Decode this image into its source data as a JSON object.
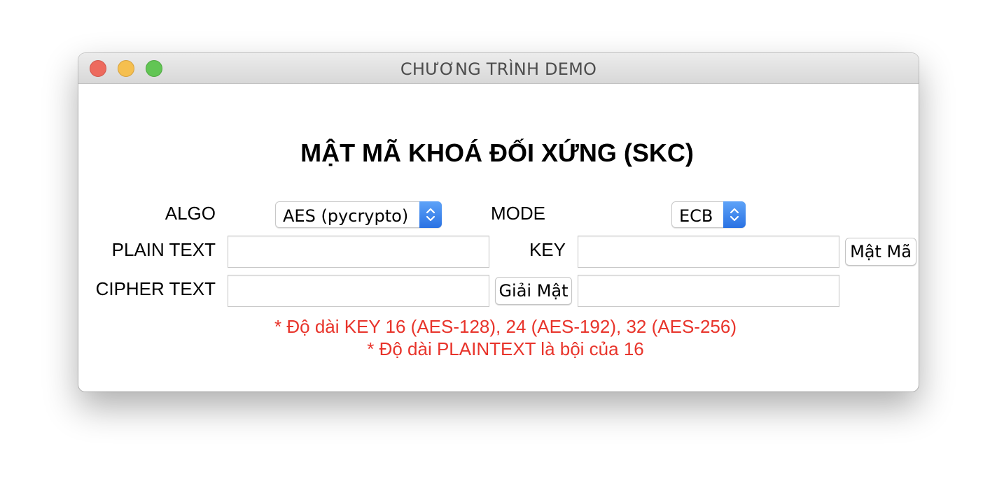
{
  "window": {
    "title": "CHƯƠNG TRÌNH DEMO"
  },
  "heading": "MẬT MÃ KHOÁ ĐỐI XỨNG (SKC)",
  "form": {
    "algo_label": "ALGO",
    "algo_value": "AES (pycrypto)",
    "mode_label": "MODE",
    "mode_value": "ECB",
    "plain_text_label": "PLAIN TEXT",
    "plain_text_value": "",
    "key_label": "KEY",
    "key_value": "",
    "cipher_text_label": "CIPHER TEXT",
    "cipher_text_value": "",
    "decrypted_value": "",
    "encrypt_button": "Mật Mã",
    "decrypt_button": "Giải Mật"
  },
  "notes": {
    "line1": "* Độ dài KEY 16 (AES-128), 24 (AES-192), 32 (AES-256)",
    "line2": "* Độ dài PLAINTEXT là bội của 16"
  },
  "colors": {
    "note": "#e8342b",
    "stepper": "#2a72e3",
    "close": "#ed6a5e",
    "minimize": "#f5bf4f",
    "zoom": "#62c554"
  }
}
